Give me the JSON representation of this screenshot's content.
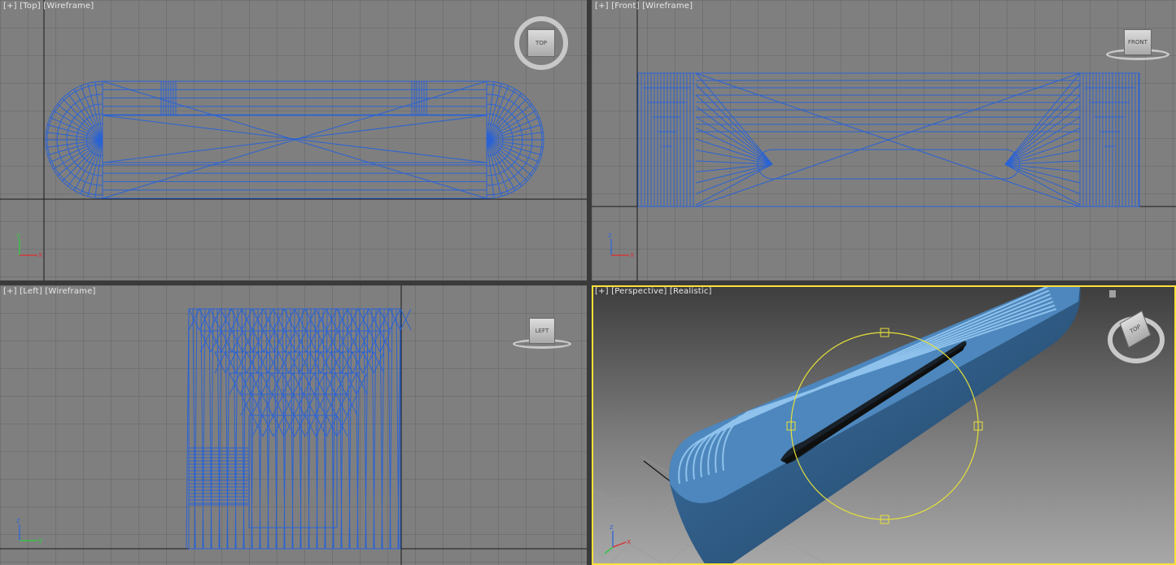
{
  "viewports": {
    "top": {
      "label": [
        "[+]",
        "[Top]",
        "[Wireframe]"
      ],
      "viewcube": "TOP"
    },
    "front": {
      "label": [
        "[+]",
        "[Front]",
        "[Wireframe]"
      ],
      "viewcube": "FRONT"
    },
    "left": {
      "label": [
        "[+]",
        "[Left]",
        "[Wireframe]"
      ],
      "viewcube": "LEFT"
    },
    "perspective": {
      "label": [
        "[+]",
        "[Perspective]",
        "[Realistic]"
      ],
      "viewcube": "TOP",
      "active": true
    }
  },
  "axes": {
    "top": {
      "vertical": "y",
      "horizontal": "x"
    },
    "front": {
      "vertical": "z",
      "horizontal": "x"
    },
    "left": {
      "vertical": "z",
      "horizontal": "y"
    },
    "perspective": {
      "vertical": "z",
      "horizontal": "x",
      "depth": "y"
    }
  },
  "colors": {
    "wireframe": "#2b63d4",
    "viewport_bg": "#7f7f7f",
    "active_border": "#ffe13a",
    "gizmo": "#e6e03a",
    "mesh_shaded": "#4d87bd",
    "axis_x": "#d23a3a",
    "axis_y": "#3ac24a",
    "axis_z": "#3a6ad2"
  },
  "icons": {
    "viewcube": "viewcube-icon",
    "axis_tripod": "axis-tripod-icon",
    "light": "light-icon"
  }
}
